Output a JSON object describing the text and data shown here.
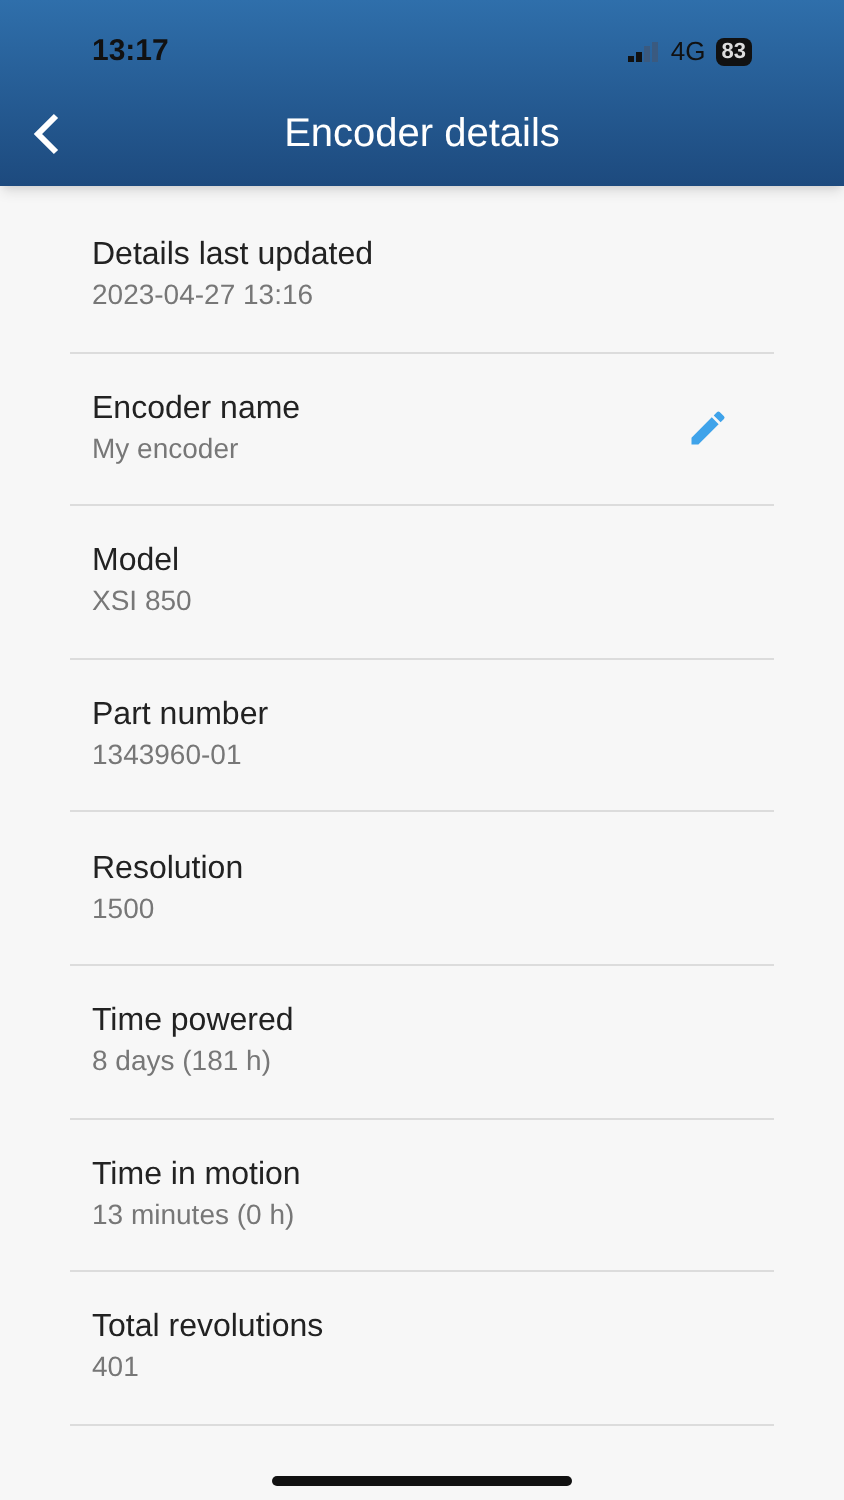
{
  "status_bar": {
    "time": "13:17",
    "network": "4G",
    "battery": "83"
  },
  "header": {
    "title": "Encoder details"
  },
  "details": [
    {
      "label": "Details last updated",
      "value": "2023-04-27 13:16",
      "editable": false
    },
    {
      "label": "Encoder name",
      "value": "My encoder",
      "editable": true
    },
    {
      "label": "Model",
      "value": "XSI 850",
      "editable": false
    },
    {
      "label": "Part number",
      "value": "1343960-01",
      "editable": false
    },
    {
      "label": "Resolution",
      "value": "1500",
      "editable": false
    },
    {
      "label": "Time powered",
      "value": "8 days (181 h)",
      "editable": false
    },
    {
      "label": "Time in motion",
      "value": "13 minutes (0 h)",
      "editable": false
    },
    {
      "label": "Total revolutions",
      "value": "401",
      "editable": false
    }
  ]
}
